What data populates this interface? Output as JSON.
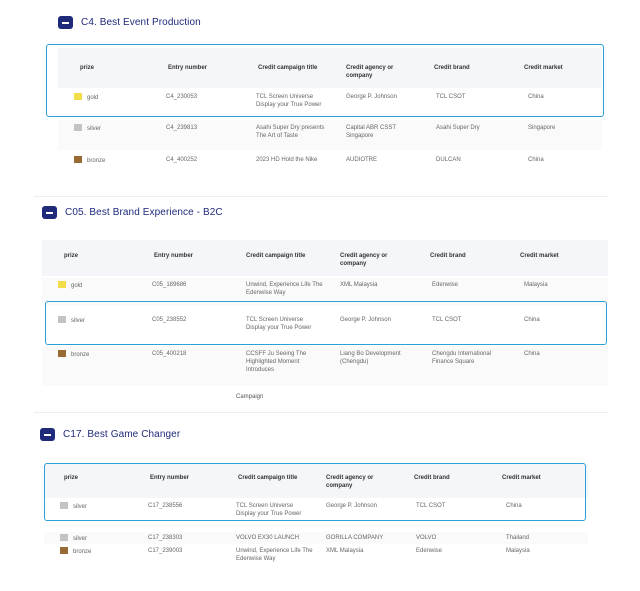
{
  "columns": [
    "prize",
    "Entry number",
    "Credit campaign title",
    "Credit agency or company",
    "Credit brand",
    "Credit market"
  ],
  "sections": [
    {
      "title": "C4. Best Event Production",
      "rows": [
        {
          "prize": "gold",
          "entry": "C4_230053",
          "title": "TCL Screen Universe Display your True Power",
          "agency": "George P. Johnson",
          "brand": "TCL CSOT",
          "market": "China"
        },
        {
          "prize": "silver",
          "entry": "C4_239813",
          "title": "Asahi Super Dry presents The Art of Taste",
          "agency": "Capital ABR CSST Singapore",
          "brand": "Asahi Super Dry",
          "market": "Singapore"
        },
        {
          "prize": "bronze",
          "entry": "C4_400252",
          "title": "2023 HD Hold the Nike",
          "agency": "AUDIOTRE",
          "brand": "DULCAN",
          "market": "China"
        }
      ]
    },
    {
      "title": "C05. Best Brand Experience - B2C",
      "rows": [
        {
          "prize": "gold",
          "entry": "C05_189686",
          "title": "Unwind, Experience Life The Edenwise Way",
          "agency": "XML Malaysia",
          "brand": "Edenwise",
          "market": "Malaysia"
        },
        {
          "prize": "silver",
          "entry": "C05_238552",
          "title": "TCL Screen Universe Display your True Power",
          "agency": "George P. Johnson",
          "brand": "TCL CSOT",
          "market": "China"
        },
        {
          "prize": "bronze",
          "entry": "C05_400218",
          "title": "CCSFF Ju Seeing The Highlighted Moment Introduces",
          "agency": "Liang Bo Development (Chengdu)",
          "brand": "Chengdu International Finance Square",
          "market": "China"
        }
      ],
      "trailing": "Campaign"
    },
    {
      "title": "C17. Best Game Changer",
      "rows": [
        {
          "prize": "silver",
          "entry": "C17_238556",
          "title": "TCL Screen Universe Display your True Power",
          "agency": "George P. Johnson",
          "brand": "TCL CSOT",
          "market": "China"
        },
        {
          "prize": "silver",
          "entry": "C17_238303",
          "title": "VOLVO EX30 LAUNCH",
          "agency": "GORILLA COMPANY",
          "brand": "VOLVO",
          "market": "Thailand"
        },
        {
          "prize": "bronze",
          "entry": "C17_239003",
          "title": "Unwind, Experience Life The Edenwise Way",
          "agency": "XML Malaysia",
          "brand": "Edenwise",
          "market": "Malaysia"
        }
      ]
    }
  ],
  "colors": {
    "accent": "#1f2a7a",
    "highlight": "#2ea0d8",
    "gold": "#f2dd4a",
    "silver": "#c3c3c3",
    "bronze": "#9a6a34"
  }
}
